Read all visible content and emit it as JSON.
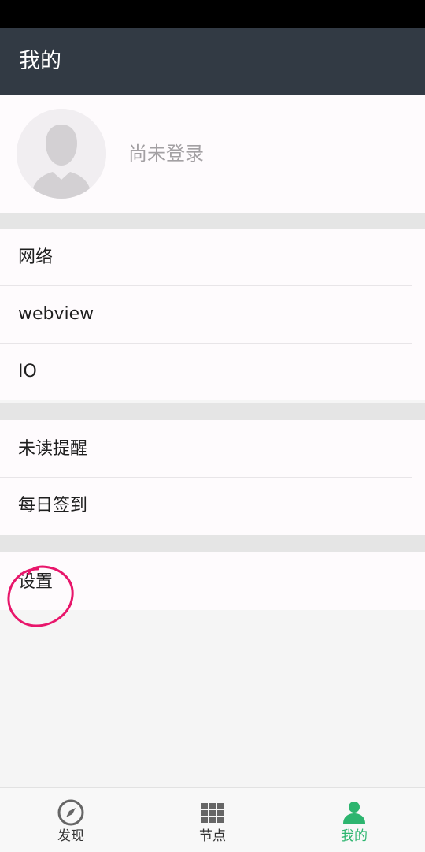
{
  "header": {
    "title": "我的"
  },
  "profile": {
    "avatar_icon": "default-user-avatar-icon",
    "login_status": "尚未登录"
  },
  "sections": [
    {
      "items": [
        {
          "label": "网络"
        },
        {
          "label": "webview"
        },
        {
          "label": "IO"
        }
      ]
    },
    {
      "items": [
        {
          "label": "未读提醒"
        },
        {
          "label": "每日签到"
        }
      ]
    },
    {
      "items": [
        {
          "label": "设置"
        }
      ]
    }
  ],
  "bottom_nav": {
    "items": [
      {
        "label": "发现",
        "icon": "compass-icon",
        "active": false
      },
      {
        "label": "节点",
        "icon": "grid-icon",
        "active": false
      },
      {
        "label": "我的",
        "icon": "person-icon",
        "active": true
      }
    ]
  },
  "colors": {
    "appbar": "#323a44",
    "active_tab": "#2db56f",
    "annotation": "#e8166b"
  }
}
